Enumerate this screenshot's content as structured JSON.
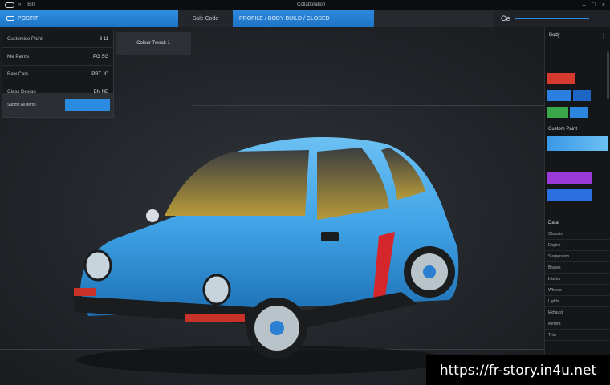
{
  "titlebar": {
    "app_label": "Bin",
    "center_label": "Collaboration"
  },
  "toolbar": {
    "project_label": "POSTIT",
    "section_label": "Sale Code",
    "mode_label": "PROFILE / BODY BUILD / CLOSED",
    "zoom_label": "Ce"
  },
  "left_panel": {
    "rows": [
      {
        "label": "Customise Paint",
        "value": "3 11"
      },
      {
        "label": "Kie Paints",
        "value": "PG SG"
      },
      {
        "label": "Raw Cars",
        "value": "PRT JC"
      },
      {
        "label": "Glass Design",
        "value": "BN NE"
      }
    ],
    "footer_label": "Submit All Items"
  },
  "tooltip": {
    "label": "Colour Tweak 1"
  },
  "right_panel": {
    "header": "Body",
    "swatch_sections": [
      {
        "colors": [
          "#d63a2f"
        ],
        "label": ""
      },
      {
        "colors": [
          "#2b7fe0",
          "#1e66c6"
        ],
        "label": ""
      },
      {
        "colors": [
          "#3aa84a",
          "#2b86e0"
        ],
        "label": ""
      }
    ],
    "paint_label": "Custom Paint",
    "secondary_swatches": [
      "#9b3ad6",
      "#2b6fe0"
    ],
    "details_label": "Data",
    "items": [
      "Chassis",
      "Engine",
      "Suspension",
      "Brakes",
      "Interior",
      "Wheels",
      "Lights",
      "Exhaust",
      "Mirrors",
      "Trim"
    ]
  },
  "colors": {
    "accent": "#2a8be0",
    "car_body": "#3fa3e6",
    "stripe": "#d4262b"
  },
  "watermark": "https://fr-story.in4u.net"
}
